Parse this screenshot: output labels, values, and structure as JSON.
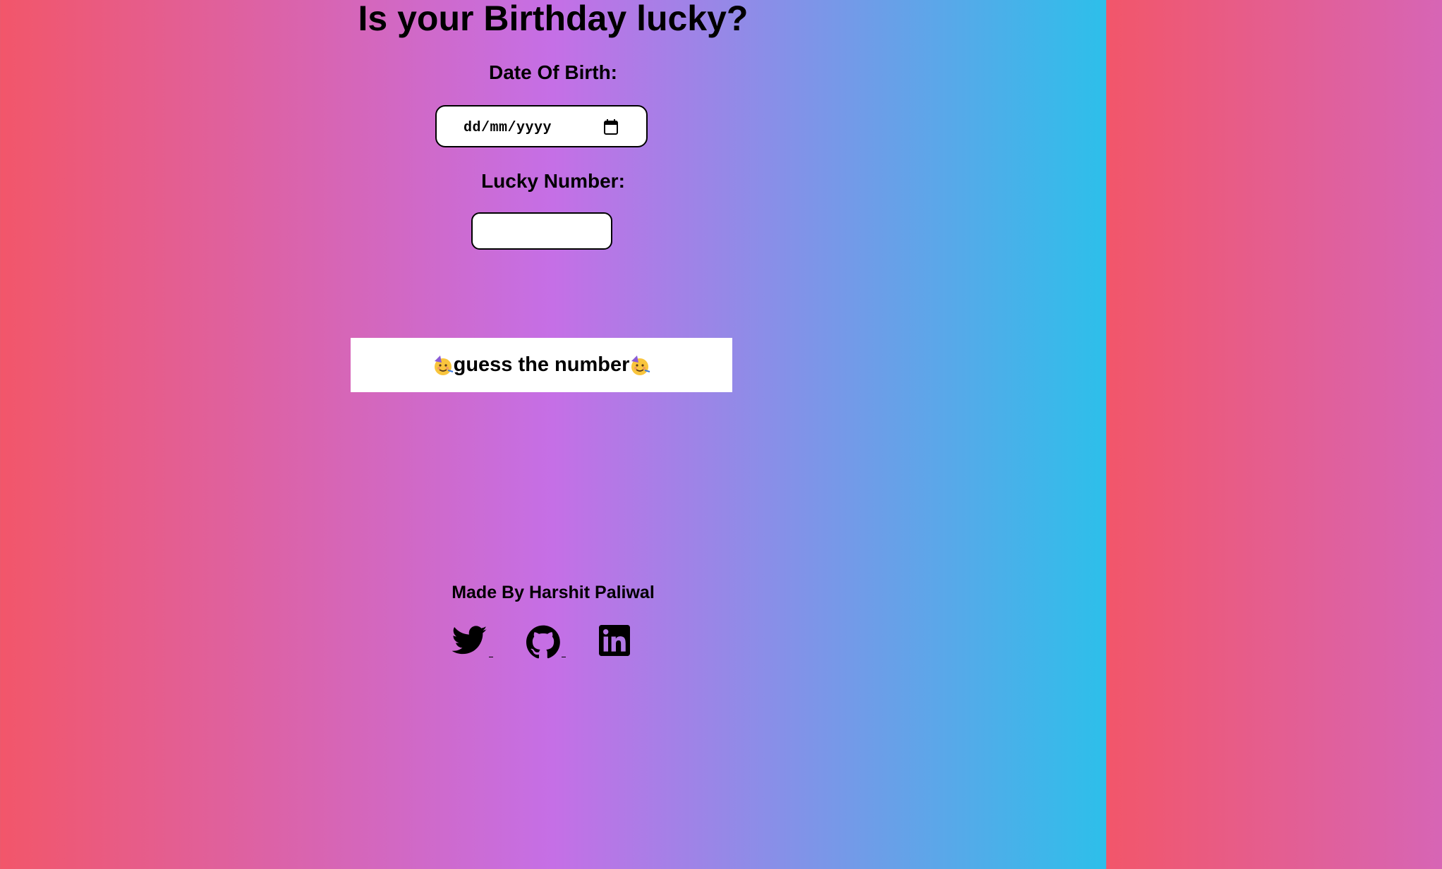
{
  "page": {
    "title": "Is your Birthday lucky?",
    "background_colors": [
      "#f2566a",
      "#c56fe6",
      "#2dbfea"
    ]
  },
  "form": {
    "dob_label": "Date Of Birth:",
    "dob_placeholder": "dd/mm/yyyy",
    "dob_value": "",
    "lucky_label": "Lucky Number:",
    "lucky_value": "",
    "button_label": "guess the number",
    "button_emoji": "partying-face-icon"
  },
  "footer": {
    "credit": "Made By Harshit Paliwal",
    "social": [
      {
        "name": "twitter",
        "icon": "twitter-icon"
      },
      {
        "name": "github",
        "icon": "github-icon"
      },
      {
        "name": "linkedin",
        "icon": "linkedin-icon"
      }
    ]
  }
}
